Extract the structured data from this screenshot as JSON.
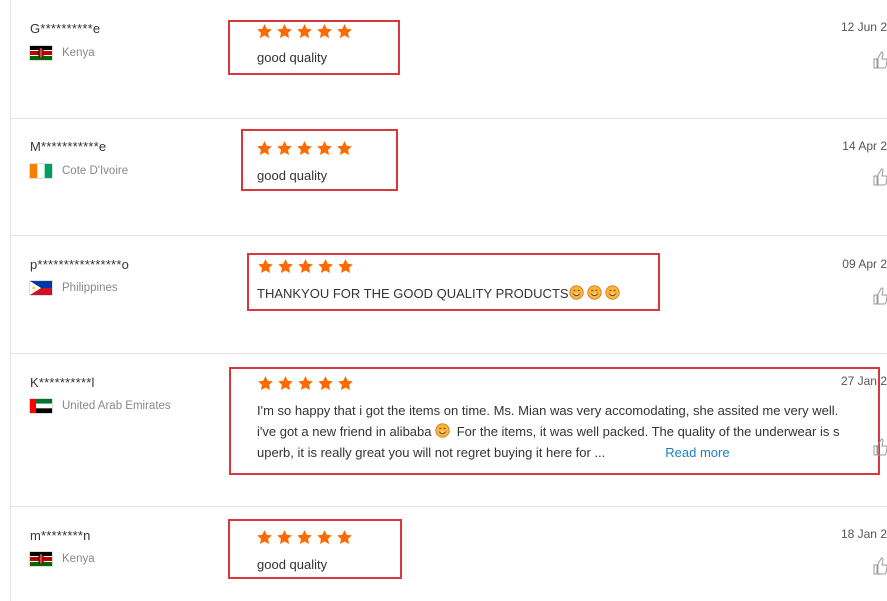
{
  "colors": {
    "star": "#ff6a00",
    "highlight_box": "#d9363e",
    "link": "#1a7fc9"
  },
  "reviews": [
    {
      "user": "G**********e",
      "country": "Kenya",
      "flag": "kenya",
      "date": "12 Jun 2",
      "rating": 5,
      "text": "good quality"
    },
    {
      "user": "M***********e",
      "country": "Cote D'Ivoire",
      "flag": "cote-divoire",
      "date": "14 Apr 2",
      "rating": 5,
      "text": "good quality"
    },
    {
      "user": "p****************o",
      "country": "Philippines",
      "flag": "philippines",
      "date": "09 Apr 2",
      "rating": 5,
      "text": "THANKYOU FOR THE GOOD QUALITY PRODUCTS",
      "emojis": 3
    },
    {
      "user": "K**********l",
      "country": "United Arab Emirates",
      "flag": "uae",
      "date": "27 Jan 2",
      "rating": 5,
      "lines": [
        "I'm so happy that i got the items on time. Ms. Mian was very accomodating, she assited me very well.",
        "i've got a new friend in alibaba",
        "For the items, it was well packed. The quality of the underwear is s",
        "uperb, it is really great you will not regret buying it here for ..."
      ],
      "read_more": "Read more"
    },
    {
      "user": "m********n",
      "country": "Kenya",
      "flag": "kenya",
      "date": "18 Jan 2",
      "rating": 5,
      "text": "good quality"
    }
  ]
}
